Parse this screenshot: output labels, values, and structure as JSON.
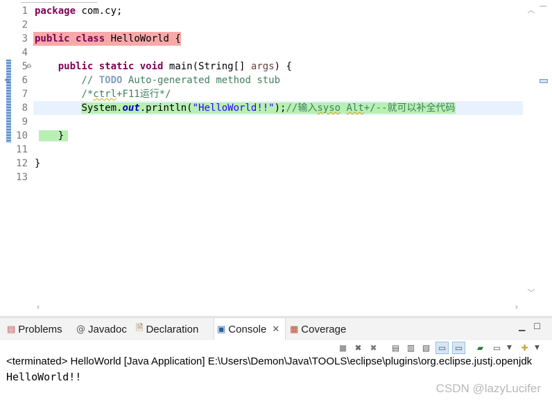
{
  "editor": {
    "line_numbers": [
      "1",
      "2",
      "3",
      "4",
      "5",
      "6",
      "7",
      "8",
      "9",
      "10",
      "11",
      "12",
      "13"
    ],
    "code": {
      "package_kw": "package",
      "package_name": " com.cy;",
      "public_kw": "public",
      "class_kw": "class",
      "class_name": " HelloWorld {",
      "static_kw": "static",
      "void_kw": "void",
      "main_sig": " main(String[] ",
      "args": "args",
      "main_end": ") {",
      "comment_prefix": "// ",
      "todo": "TODO",
      "comment_rest": " Auto-generated method stub",
      "comment2_a": "/*",
      "comment2_b": "ctrl",
      "comment2_c": "+F11运行*/",
      "sysout_a": "System.",
      "sysout_field": "out",
      "sysout_b": ".println(",
      "sysout_str": "\"HelloWorld!!\"",
      "sysout_c": ");",
      "tail_comment_a": "//输入",
      "tail_comment_b": "syso",
      "tail_comment_c": " ",
      "tail_comment_d": "Alt",
      "tail_comment_e": "+/--就可以补全代码",
      "close_brace_method": "}",
      "close_brace_class": "}"
    }
  },
  "console_view": {
    "tabs": [
      {
        "label": "Problems",
        "icon": "problems-icon"
      },
      {
        "label": "Javadoc",
        "icon": "at-icon"
      },
      {
        "label": "Declaration",
        "icon": "declaration-icon"
      },
      {
        "label": "Console",
        "icon": "console-icon"
      },
      {
        "label": "Coverage",
        "icon": "coverage-icon"
      }
    ],
    "terminated_text": "<terminated> HelloWorld [Java Application] E:\\Users\\Demon\\Java\\TOOLS\\eclipse\\plugins\\org.eclipse.justj.openjdk",
    "output": "HelloWorld!!"
  },
  "watermark": "CSDN @lazyLucifer"
}
